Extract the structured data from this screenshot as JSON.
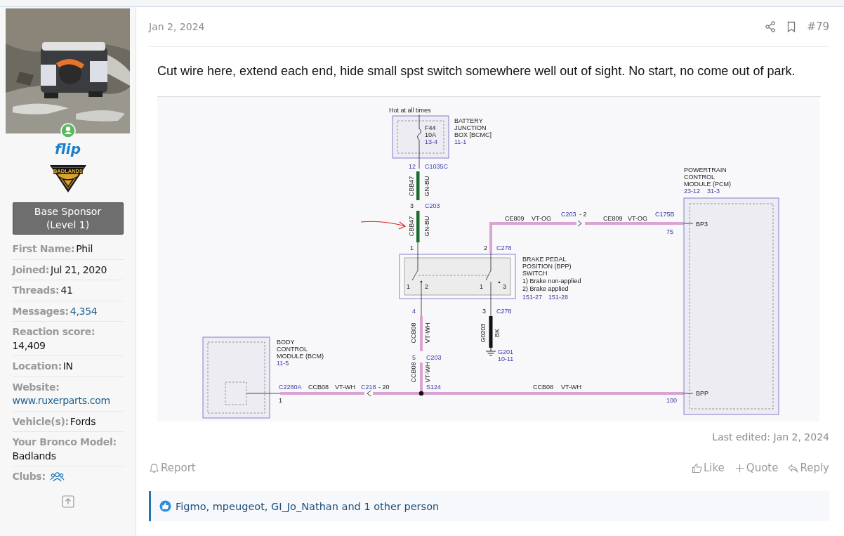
{
  "user": {
    "name": "flip",
    "online": true,
    "badge": "BADLANDS",
    "banner": "Base Sponsor (Level 1)",
    "fields": [
      {
        "label": "First Name:",
        "value": "Phil",
        "kind": "text",
        "link": false
      },
      {
        "label": "Joined:",
        "value": "Jul 21, 2020",
        "kind": "text",
        "link": false
      },
      {
        "label": "Threads:",
        "value": "41",
        "kind": "text",
        "link": false
      },
      {
        "label": "Messages:",
        "value": "4,354",
        "kind": "text",
        "link": true
      },
      {
        "label": "Reaction score:",
        "value": "14,409",
        "kind": "text",
        "link": false
      },
      {
        "label": "Location:",
        "value": "IN",
        "kind": "text",
        "link": false
      },
      {
        "label": "Website:",
        "value": "www.ruxerparts.com",
        "kind": "text",
        "link": true
      },
      {
        "label": "Vehicle(s):",
        "value": "Fords",
        "kind": "text",
        "link": false
      },
      {
        "label": "Your Bronco Model:",
        "value": "Badlands",
        "kind": "text",
        "link": false
      },
      {
        "label": "Clubs:",
        "kind": "clubs"
      }
    ]
  },
  "post": {
    "date": "Jan 2, 2024",
    "number": "#79",
    "text": "Cut wire here, extend each end, hide small spst switch somewhere well out of sight. No start, no come out of park.",
    "diagram": {
      "labels": [
        {
          "text": "Hot at all times",
          "kind": "text"
        },
        {
          "text": "BATTERY",
          "kind": "text"
        },
        {
          "text": "F44",
          "kind": "text"
        },
        {
          "text": "JUNCTION",
          "kind": "text"
        },
        {
          "text": "10A",
          "kind": "text"
        },
        {
          "text": "BOX [BCMC]",
          "kind": "text"
        },
        {
          "text": "13-4",
          "kind": "ref"
        },
        {
          "text": "11-1",
          "kind": "ref"
        },
        {
          "text": "12",
          "kind": "ref"
        },
        {
          "text": "C1035C",
          "kind": "ref"
        },
        {
          "text": "POWERTRAIN",
          "kind": "text"
        },
        {
          "text": "CONTROL",
          "kind": "text"
        },
        {
          "text": "CBB47",
          "kind": "vertical"
        },
        {
          "text": "GN-BU",
          "kind": "vertical"
        },
        {
          "text": "MODULE (PCM)",
          "kind": "text"
        },
        {
          "text": "23-12",
          "kind": "ref"
        },
        {
          "text": "31-3",
          "kind": "ref"
        },
        {
          "text": "3",
          "kind": "text"
        },
        {
          "text": "C203",
          "kind": "ref"
        },
        {
          "text": "C203",
          "kind": "ref"
        },
        {
          "text": "- 2",
          "kind": "text"
        },
        {
          "text": "C175B",
          "kind": "ref"
        },
        {
          "text": "CE809",
          "kind": "text"
        },
        {
          "text": "VT-OG",
          "kind": "text"
        },
        {
          "text": "CE809",
          "kind": "text"
        },
        {
          "text": "VT-OG",
          "kind": "text"
        },
        {
          "text": "CBB47",
          "kind": "vertical"
        },
        {
          "text": "GN-BU",
          "kind": "vertical"
        },
        {
          "text": "BP3",
          "kind": "text"
        },
        {
          "text": "75",
          "kind": "ref"
        },
        {
          "text": "1",
          "kind": "text"
        },
        {
          "text": "2",
          "kind": "text"
        },
        {
          "text": "C278",
          "kind": "ref"
        },
        {
          "text": "BRAKE PEDAL",
          "kind": "text"
        },
        {
          "text": "POSITION (BPP)",
          "kind": "text"
        },
        {
          "text": "SWITCH",
          "kind": "text"
        },
        {
          "text": "1) Brake non-applied",
          "kind": "text"
        },
        {
          "text": "1",
          "kind": "text"
        },
        {
          "text": "2",
          "kind": "text"
        },
        {
          "text": "1",
          "kind": "text"
        },
        {
          "text": "3",
          "kind": "text"
        },
        {
          "text": "2) Brake applied",
          "kind": "text"
        },
        {
          "text": "151-27",
          "kind": "ref"
        },
        {
          "text": "151-28",
          "kind": "ref"
        },
        {
          "text": "4",
          "kind": "ref"
        },
        {
          "text": "3",
          "kind": "text"
        },
        {
          "text": "C278",
          "kind": "ref"
        },
        {
          "text": "CCB08",
          "kind": "vertical"
        },
        {
          "text": "VT-WH",
          "kind": "vertical"
        },
        {
          "text": "G0203",
          "kind": "vertical"
        },
        {
          "text": "BK",
          "kind": "vertical"
        },
        {
          "text": "BODY",
          "kind": "text"
        },
        {
          "text": "CONTROL",
          "kind": "text"
        },
        {
          "text": "G201",
          "kind": "ref"
        },
        {
          "text": "MODULE (BCM)",
          "kind": "text"
        },
        {
          "text": "5",
          "kind": "ref"
        },
        {
          "text": "C203",
          "kind": "ref"
        },
        {
          "text": "10-11",
          "kind": "ref"
        },
        {
          "text": "11-5",
          "kind": "ref"
        },
        {
          "text": "CCB08",
          "kind": "vertical"
        },
        {
          "text": "VT-WH",
          "kind": "vertical"
        },
        {
          "text": "C2280A",
          "kind": "ref"
        },
        {
          "text": "CCB08",
          "kind": "text"
        },
        {
          "text": "VT-WH",
          "kind": "text"
        },
        {
          "text": "C218",
          "kind": "ref"
        },
        {
          "text": "- 20",
          "kind": "text"
        },
        {
          "text": "S124",
          "kind": "ref"
        },
        {
          "text": "CCB08",
          "kind": "text"
        },
        {
          "text": "VT-WH",
          "kind": "text"
        },
        {
          "text": "BPP",
          "kind": "text"
        },
        {
          "text": "1",
          "kind": "text"
        },
        {
          "text": "100",
          "kind": "ref"
        }
      ]
    },
    "last_edited": "Last edited: Jan 2, 2024",
    "actions": [
      {
        "label": "Report",
        "kind": "report"
      },
      {
        "label": "Like",
        "kind": "like"
      },
      {
        "label": "Quote",
        "kind": "quote"
      },
      {
        "label": "Reply",
        "kind": "reply"
      }
    ],
    "reactions": "Figmo, mpeugeot, GI_Jo_Nathan and 1 other person"
  }
}
